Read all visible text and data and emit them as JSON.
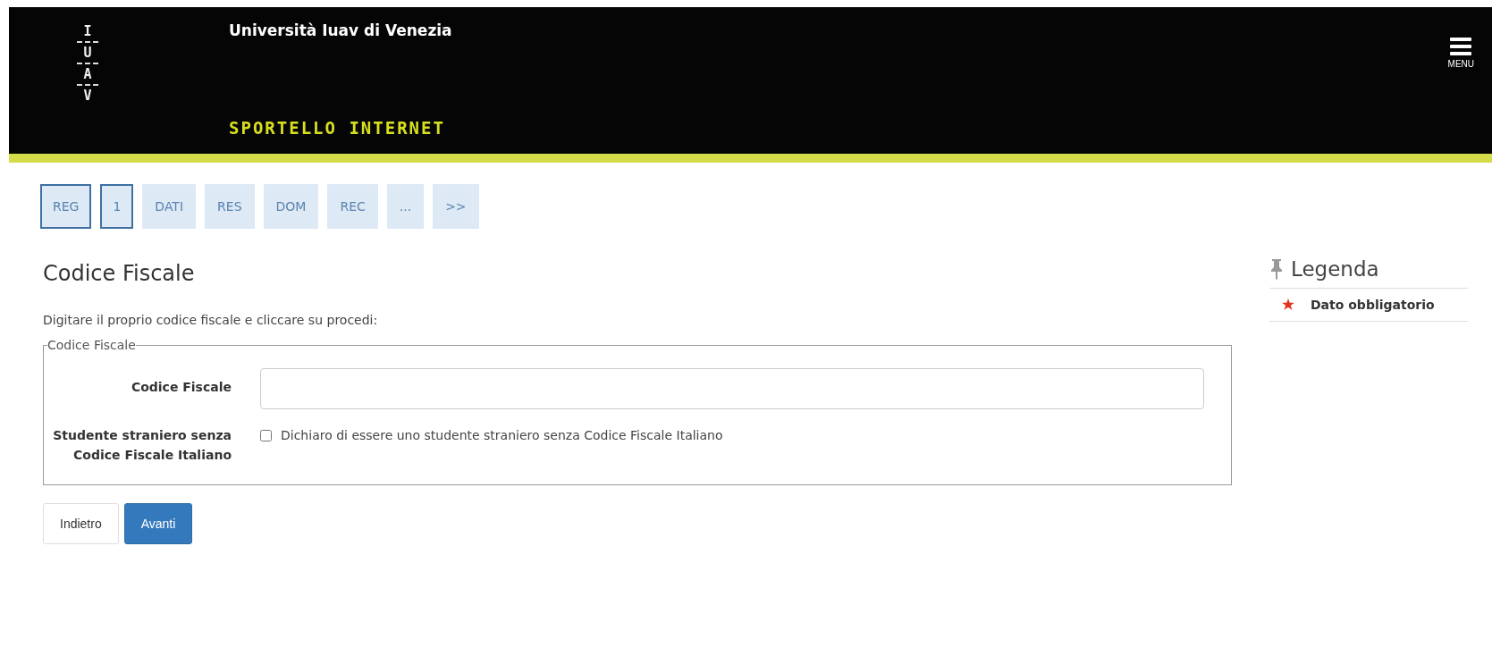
{
  "header": {
    "logo_letters": [
      "I",
      "U",
      "A",
      "V"
    ],
    "university": "Università Iuav di Venezia",
    "portal": "SPORTELLO INTERNET",
    "menu": {
      "label": "MENU"
    }
  },
  "steps": [
    {
      "label": "REG",
      "selected": true
    },
    {
      "label": "1",
      "selected": true
    },
    {
      "label": "DATI",
      "selected": false
    },
    {
      "label": "RES",
      "selected": false
    },
    {
      "label": "DOM",
      "selected": false
    },
    {
      "label": "REC",
      "selected": false
    },
    {
      "label": "...",
      "selected": false
    },
    {
      "label": ">>",
      "selected": false
    }
  ],
  "page_title": "Codice Fiscale",
  "instructions": "Digitare il proprio codice fiscale e cliccare su procedi:",
  "fieldset": {
    "legend": "Codice Fiscale",
    "fields": [
      {
        "kind": "text",
        "label": "Codice Fiscale"
      },
      {
        "kind": "checkbox",
        "label": "Studente straniero senza Codice Fiscale Italiano",
        "option": "Dichiaro di essere uno studente straniero senza Codice Fiscale Italiano",
        "checked": false
      }
    ]
  },
  "buttons": [
    {
      "label": "Indietro",
      "kind": "default"
    },
    {
      "label": "Avanti",
      "kind": "primary"
    }
  ],
  "legend_panel": {
    "title": "Legenda",
    "items": [
      {
        "label": "Dato obbligatorio"
      }
    ]
  }
}
